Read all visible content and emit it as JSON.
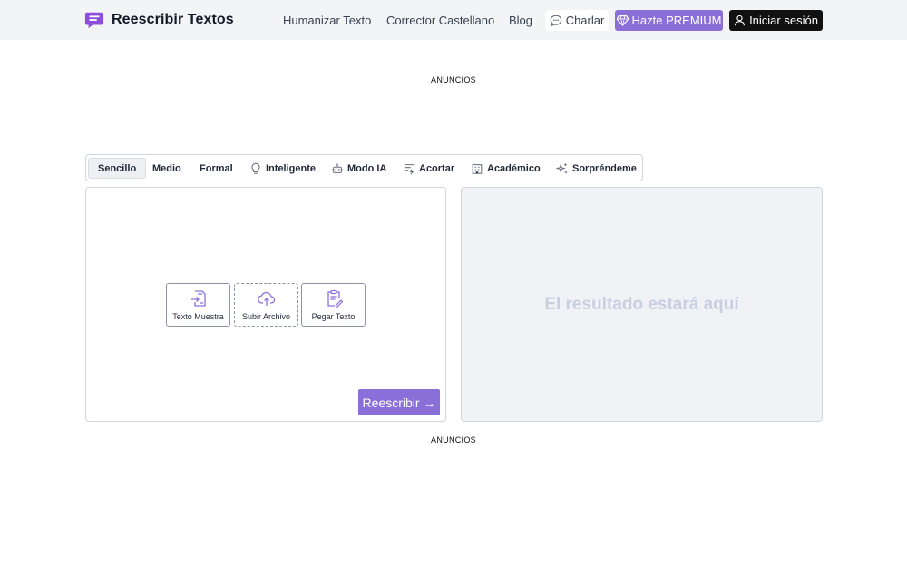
{
  "header": {
    "brand_name": "Reescribir Textos",
    "nav": [
      "Humanizar Texto",
      "Corrector Castellano",
      "Blog"
    ],
    "charlar_label": "Charlar",
    "premium_label": "Hazte PREMIUM",
    "login_label": "Iniciar sesión"
  },
  "ads": {
    "top_label": "ANUNCIOS",
    "bottom_label": "ANUNCIOS"
  },
  "modes": {
    "items": [
      {
        "label": "Sencillo",
        "icon": "none"
      },
      {
        "label": "Medio",
        "icon": "none"
      },
      {
        "label": "Formal",
        "icon": "none"
      },
      {
        "label": "Inteligente",
        "icon": "lightbulb-icon"
      },
      {
        "label": "Modo IA",
        "icon": "robot-icon"
      },
      {
        "label": "Acortar",
        "icon": "shorten-icon"
      },
      {
        "label": "Académico",
        "icon": "building-icon"
      },
      {
        "label": "Sorpréndeme",
        "icon": "sparkle-icon"
      }
    ],
    "active": "Sencillo"
  },
  "editor": {
    "actions": [
      "Texto Muestra",
      "Subir Archivo",
      "Pegar Texto"
    ],
    "rewrite_label": "Reescribir →"
  },
  "result": {
    "placeholder": "El resultado estará aquí"
  },
  "colors": {
    "accent": "#8b6fd9",
    "dark": "#111111",
    "header_bg": "#f3f4f6"
  }
}
